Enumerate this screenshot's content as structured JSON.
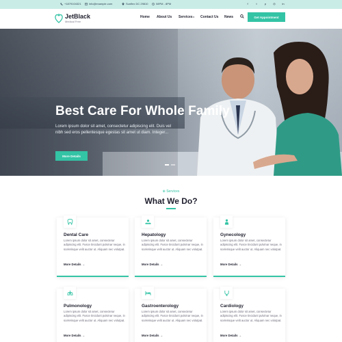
{
  "topbar": {
    "phone": "+1879104321",
    "email": "info@example.com",
    "address": "Sunflex DC 29810",
    "hours": "08PM - 8PM",
    "socials": [
      "facebook-icon",
      "twitter-icon",
      "pinterest-icon",
      "instagram-icon",
      "linkedin-icon"
    ]
  },
  "header": {
    "brand": "JetBlack",
    "tagline": "Medical Free",
    "nav": [
      "Home",
      "About Us",
      "Services",
      "Contact Us",
      "News"
    ],
    "cta": "Get Appointment"
  },
  "hero": {
    "title": "Best Care For Whole Family",
    "lede": "Lorem ipsum dolor sit amet, consectetur adipiscing elit. Duis vel nibh sed eros pellentesque egestas sit amet ut diam. Integer...",
    "button": "More Details"
  },
  "services": {
    "eyebrow": "Services",
    "title": "What We Do?",
    "cards": [
      {
        "title": "Dental Care",
        "desc": "Lorem ipsum dolor sit amet, consectetur adipiscing elit. Fusce tincidunt pulvinar neque, in scelerisque velit auctor ut. Aliquam nec volutpat.",
        "more": "More Details",
        "icon": "tooth-icon"
      },
      {
        "title": "Hepatology",
        "desc": "Lorem ipsum dolor sit amet, consectetur adipiscing elit. Fusce tincidunt pulvinar neque, in scelerisque velit auctor ut. Aliquam nec volutpat.",
        "more": "More Details",
        "icon": "hand-care-icon"
      },
      {
        "title": "Gynecology",
        "desc": "Lorem ipsum dolor sit amet, consectetur adipiscing elit. Fusce tincidunt pulvinar neque, in scelerisque velit auctor ut. Aliquam nec volutpat.",
        "more": "More Details",
        "icon": "person-icon"
      },
      {
        "title": "Pulmonology",
        "desc": "Lorem ipsum dolor sit amet, consectetur adipiscing elit. Fusce tincidunt pulvinar neque, in scelerisque velit auctor ut. Aliquam nec volutpat.",
        "more": "More Details",
        "icon": "lungs-icon"
      },
      {
        "title": "Gastroenterology",
        "desc": "Lorem ipsum dolor sit amet, consectetur adipiscing elit. Fusce tincidunt pulvinar neque, in scelerisque velit auctor ut. Aliquam nec volutpat.",
        "more": "More Details",
        "icon": "bed-icon"
      },
      {
        "title": "Cardiology",
        "desc": "Lorem ipsum dolor sit amet, consectetur adipiscing elit. Fusce tincidunt pulvinar neque, in scelerisque velit auctor ut. Aliquam nec volutpat.",
        "more": "More Details",
        "icon": "stethoscope-icon"
      }
    ]
  },
  "colors": {
    "accent": "#33c3a5",
    "topbar": "#c9ece6",
    "text": "#1f1f2e"
  }
}
